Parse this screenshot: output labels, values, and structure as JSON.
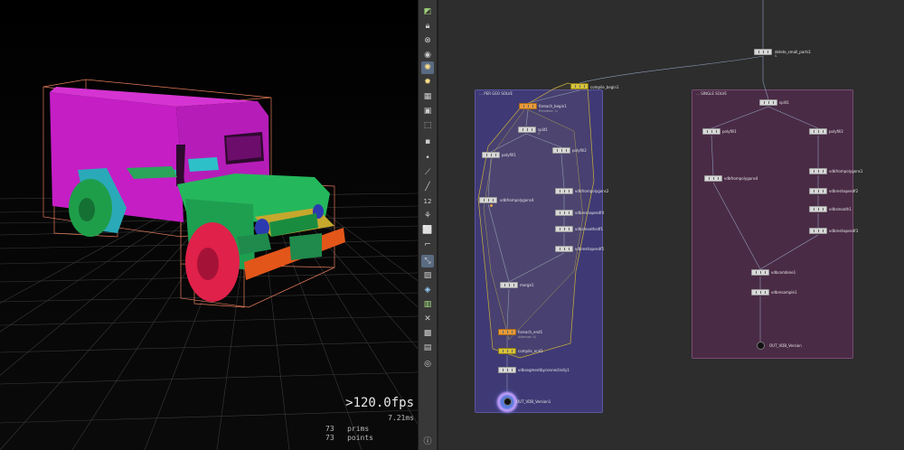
{
  "viewport": {
    "fps": ">120.0fps",
    "ms": "7.21ms",
    "prims_count": "73",
    "prims_label": "prims",
    "points_count": "73",
    "points_label": "points"
  },
  "toolbar": {
    "icons": [
      "snap-icon",
      "lock-icon",
      "ghost-icon",
      "display-icon",
      "light-icon",
      "light-toggle-icon",
      "background-icon",
      "camera-icon",
      "select-icon",
      "point-icon",
      "curve-icon",
      "brush-icon",
      "numbers-icon",
      "wire-icon",
      "template-icon",
      "vis-icon",
      "grid-icon",
      "shade-icon",
      "geometry-icon",
      "spline-icon",
      "camera2-icon",
      "image-icon",
      "pin-icon",
      "info-icon"
    ]
  },
  "network": {
    "top_node": {
      "label": "delete_small_parts1",
      "flag": "IL"
    },
    "compile_begin": "compile_begin1",
    "box_left": {
      "title": "PER GEO SOLVE",
      "nodes": {
        "foreach_begin": "foreach_begin1",
        "foreach_begin_sub": "Primitive: 1/",
        "split": "split1",
        "split_flag": "0",
        "poly_left": "polyfill1",
        "poly_right": "polyfill2",
        "vdb_left": "vdbfrompolygons4",
        "vdb_right": "vdbfrompolygons2",
        "reshape_a": "vdbreshapesdf4",
        "smooth": "vdbsmoothsdf1",
        "reshape_b": "vdbreshapesdf5",
        "merge": "merge1",
        "foreach_end": "foreach_end1",
        "foreach_end_sub": "Attempt: 0/",
        "compile_end": "compile_end1",
        "seg_conn": "vdbsegmentbyconnectivity1",
        "out": "OUT_VDB_Version1"
      }
    },
    "box_right": {
      "title": "SINGLE SOLVE",
      "nodes": {
        "split": "split1",
        "poly_left": "polyfill1",
        "poly_right": "polyfill2",
        "vdb_left": "vdbfrompolygons4",
        "vdb_right": "vdbfrompolygons1",
        "reshape_a": "vdbreshapesdf2",
        "smooth": "vdbsmooth1",
        "reshape_b": "vdbreshapesdf3",
        "combine": "vdbcombine1",
        "resample": "vdbresample1",
        "out": "OUT_VDB_Version"
      }
    }
  }
}
